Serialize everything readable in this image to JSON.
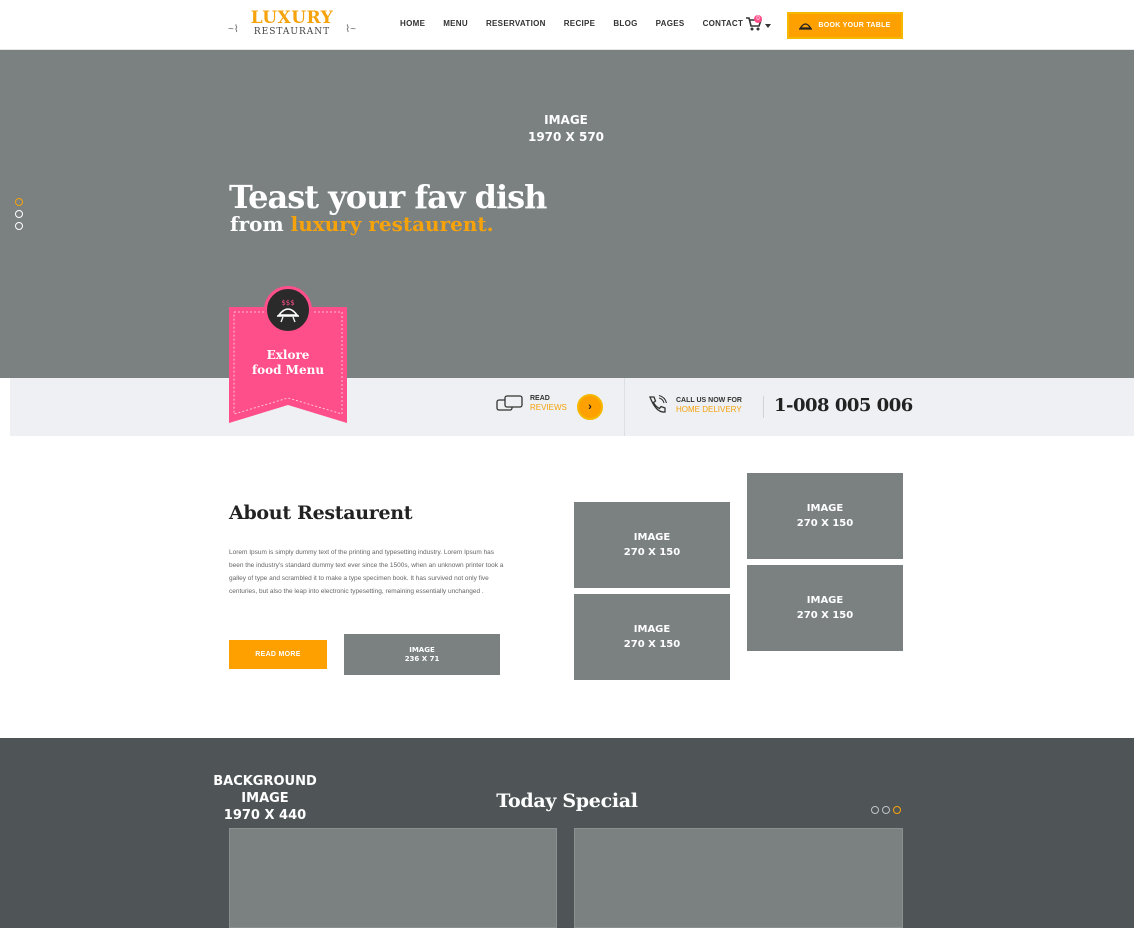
{
  "brand": {
    "logo_top": "LUXURY",
    "logo_bottom": "RESTAURANT",
    "accent_color": "#f5a20b",
    "pink_color": "#ff4f8b"
  },
  "nav": {
    "items": [
      "HOME",
      "MENU",
      "RESERVATION",
      "RECIPE",
      "BLOG",
      "PAGES",
      "CONTACT"
    ],
    "cart_count": "0",
    "book_label": "BOOK YOUR TABLE"
  },
  "hero": {
    "placeholder_line1": "IMAGE",
    "placeholder_line2": "1970 X 570",
    "title": "Teast your fav dish",
    "subtitle_prefix": "from ",
    "subtitle_highlight": "luxury restaurent."
  },
  "ribbon": {
    "line1": "Exlore",
    "line2": "food Menu",
    "icon_text": "$$$"
  },
  "info": {
    "read_label": "READ",
    "reviews_label": "REVIEWS",
    "call_label": "CALL US NOW FOR",
    "delivery_label": "HOME DELIVERY",
    "phone": "1-008 005 006"
  },
  "about": {
    "title": "About Restaurent",
    "text": "Lorem Ipsum is simply dummy text of the printing and typesetting industry. Lorem Ipsum has been the industry's standard dummy text ever since the 1500s, when an unknown printer took a galley of type and scrambled it to make a type specimen book. It has survived not only five centuries, but also the leap into electronic typesetting, remaining essentially unchanged .",
    "read_more": "READ MORE",
    "small_image_line1": "IMAGE",
    "small_image_line2": "236 X 71",
    "gallery": [
      {
        "line1": "IMAGE",
        "line2": "270 X 150"
      },
      {
        "line1": "IMAGE",
        "line2": "270 X 150"
      },
      {
        "line1": "IMAGE",
        "line2": "270 X 150"
      },
      {
        "line1": "IMAGE",
        "line2": "270 X 150"
      }
    ]
  },
  "special": {
    "bg_line1": "BACKGROUND IMAGE",
    "bg_line2": "1970 X 440",
    "title": "Today Special"
  }
}
